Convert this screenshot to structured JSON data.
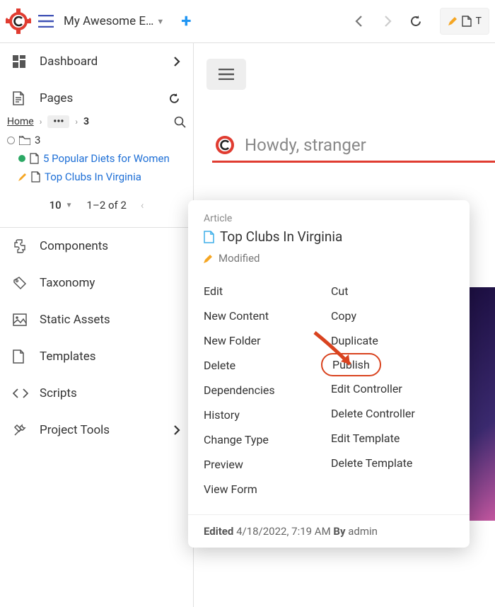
{
  "topbar": {
    "site_name": "My Awesome E…",
    "address_text": "T"
  },
  "sidebar": {
    "dashboard": "Dashboard",
    "pages": "Pages",
    "components": "Components",
    "taxonomy": "Taxonomy",
    "static_assets": "Static Assets",
    "templates": "Templates",
    "scripts": "Scripts",
    "project_tools": "Project Tools"
  },
  "breadcrumb": {
    "home": "Home",
    "current": "3"
  },
  "tree": {
    "folder_label": "3",
    "item1": "5 Popular Diets for Women",
    "item2": "Top Clubs In Virginia"
  },
  "pager": {
    "size": "10",
    "range": "1–2 of 2"
  },
  "content": {
    "howdy": "Howdy, stranger"
  },
  "ctx": {
    "type": "Article",
    "title": "Top Clubs In Virginia",
    "modified": "Modified",
    "left": [
      "Edit",
      "New Content",
      "New Folder",
      "Delete",
      "Dependencies",
      "History",
      "Change Type",
      "Preview",
      "View Form"
    ],
    "right": [
      "Cut",
      "Copy",
      "Duplicate",
      "Publish",
      "Edit Controller",
      "Delete Controller",
      "Edit Template",
      "Delete Template"
    ],
    "footer_edited_lbl": "Edited",
    "footer_date": "4/18/2022, 7:19 AM",
    "footer_by_lbl": "By",
    "footer_user": "admin"
  }
}
